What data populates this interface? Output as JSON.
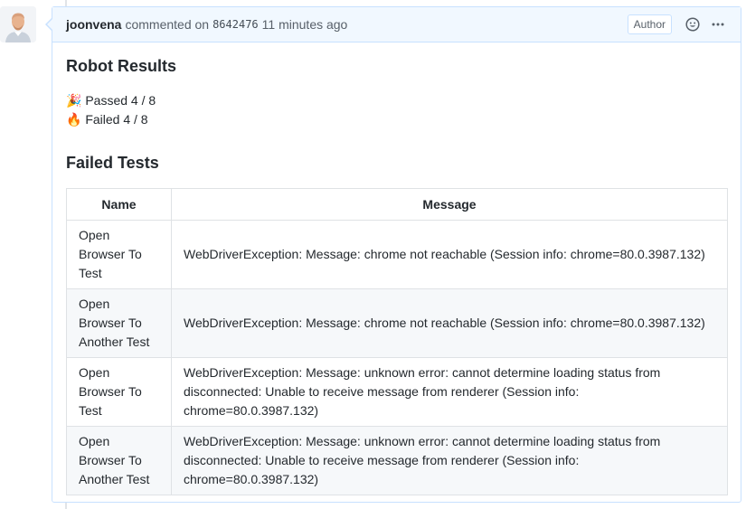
{
  "comment": {
    "author": "joonvena",
    "action": "commented on",
    "commit": "8642476",
    "time": "11 minutes ago",
    "badge": "Author"
  },
  "icons": {
    "avatar": "user-avatar",
    "reaction": "smiley-icon",
    "menu": "kebab-icon",
    "passed": "party-popper-icon",
    "failed": "fire-icon"
  },
  "body": {
    "heading": "Robot Results",
    "passed_label": "Passed 4 / 8",
    "failed_label": "Failed 4 / 8",
    "failed_heading": "Failed Tests"
  },
  "table": {
    "headers": [
      "Name",
      "Message"
    ],
    "rows": [
      {
        "name": "Open Browser To Test",
        "message": "WebDriverException: Message: chrome not reachable (Session info: chrome=80.0.3987.132)"
      },
      {
        "name": "Open Browser To Another Test",
        "message": "WebDriverException: Message: chrome not reachable (Session info: chrome=80.0.3987.132)"
      },
      {
        "name": "Open Browser To Test",
        "message": "WebDriverException: Message: unknown error: cannot determine loading status from disconnected: Unable to receive message from renderer (Session info: chrome=80.0.3987.132)"
      },
      {
        "name": "Open Browser To Another Test",
        "message": "WebDriverException: Message: unknown error: cannot determine loading status from disconnected: Unable to receive message from renderer (Session info: chrome=80.0.3987.132)"
      }
    ]
  },
  "colors": {
    "header_bg": "#f1f8ff",
    "border": "#c8e1ff",
    "alt_row": "#f6f8fa"
  }
}
